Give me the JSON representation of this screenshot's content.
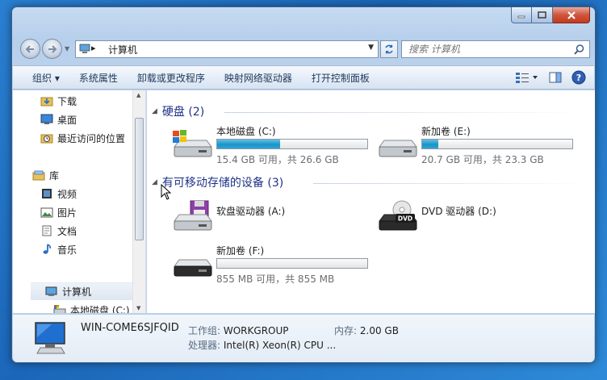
{
  "address": {
    "root_chevron": "▸",
    "crumb": "计算机"
  },
  "search": {
    "placeholder": "搜索 计算机"
  },
  "toolbar": {
    "organize": "组织 ▾",
    "system_properties": "系统属性",
    "uninstall": "卸载或更改程序",
    "map_drive": "映射网络驱动器",
    "control_panel": "打开控制面板"
  },
  "sidebar": {
    "items": [
      {
        "label": "下载"
      },
      {
        "label": "桌面"
      },
      {
        "label": "最近访问的位置"
      },
      {
        "label": "库"
      },
      {
        "label": "视频"
      },
      {
        "label": "图片"
      },
      {
        "label": "文档"
      },
      {
        "label": "音乐"
      },
      {
        "label": "计算机"
      },
      {
        "label": "本地磁盘 (C:)"
      }
    ]
  },
  "groups": {
    "hard_disks": {
      "title": "硬盘 (2)"
    },
    "removable": {
      "title": "有可移动存储的设备 (3)"
    }
  },
  "drives": {
    "c": {
      "name": "本地磁盘 (C:)",
      "info": "15.4 GB 可用，共 26.6 GB",
      "used_fraction": 0.42
    },
    "e": {
      "name": "新加卷 (E:)",
      "info": "20.7 GB 可用，共 23.3 GB",
      "used_fraction": 0.11
    },
    "a": {
      "name": "软盘驱动器 (A:)"
    },
    "d": {
      "name": "DVD 驱动器 (D:)",
      "badge": "DVD"
    },
    "f": {
      "name": "新加卷 (F:)",
      "info": "855 MB 可用，共 855 MB",
      "used_fraction": 0.0
    }
  },
  "details": {
    "pc_name": "WIN-COME6SJFQID",
    "workgroup_label": "工作组:",
    "workgroup_value": "WORKGROUP",
    "memory_label": "内存:",
    "memory_value": "2.00 GB",
    "cpu_label": "处理器:",
    "cpu_value": "Intel(R) Xeon(R) CPU ..."
  },
  "colors": {
    "accent": "#1e3287",
    "bar_fill": "#1f93c6"
  }
}
